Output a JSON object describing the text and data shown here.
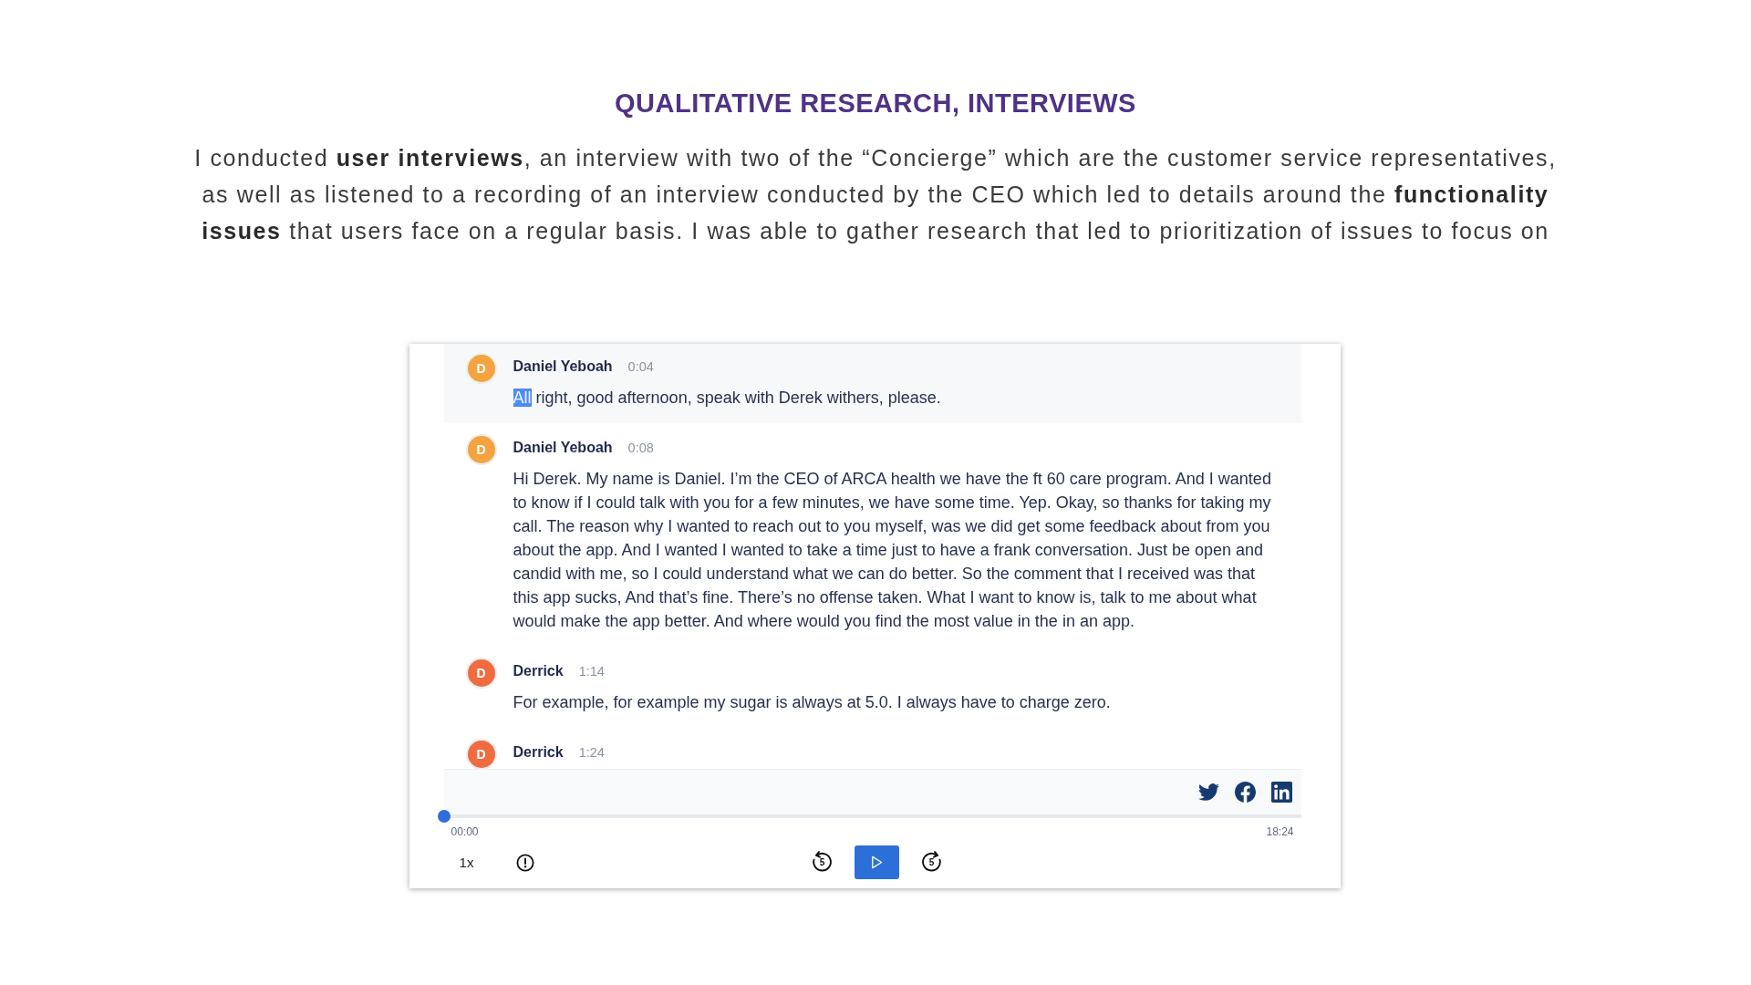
{
  "heading": "QUALITATIVE RESEARCH, INTERVIEWS",
  "intro": "I conducted **user interviews**, an interview with two of the “Concierge” which are the customer service representatives, as well as listened to a recording of an interview conducted by the CEO which led to details around the **functionality issues** that users face on a regular basis. I was able to gather research that led to prioritization of issues to focus on",
  "transcript": {
    "messages": [
      {
        "speaker": "Daniel Yeboah",
        "initial": "D",
        "color": "#f5a33e",
        "time": "0:04",
        "segments": [
          {
            "text": "All",
            "highlighted": true
          },
          {
            "text": " right, good afternoon, speak with Derek withers, please.",
            "highlighted": false
          }
        ]
      },
      {
        "speaker": "Daniel Yeboah",
        "initial": "D",
        "color": "#f5a33e",
        "time": "0:08",
        "segments": [
          {
            "text": "Hi Derek. My name is Daniel. I’m the CEO of ARCA health we have the ft 60 care program. And I wanted to know if I could talk with you for a few minutes, we have some time. Yep. Okay, so thanks for taking my call. The reason why I wanted to reach out to you myself, was we did get some feedback about from you about the app. And I wanted I wanted to take a time just to have a frank conversation. Just be open and candid with me, so I could understand what we can do better. So the comment that I received was that this app sucks, And that’s fine. There’s no offense taken. What I want to know is, talk to me about what would make the app better. And where would you find the most value in the in an app.",
            "highlighted": false
          }
        ]
      },
      {
        "speaker": "Derrick",
        "initial": "D",
        "color": "#f06b40",
        "time": "1:14",
        "segments": [
          {
            "text": "For example, for example my sugar is always at 5.0. I always have to charge zero.",
            "highlighted": false
          }
        ]
      },
      {
        "speaker": "Derrick",
        "initial": "D",
        "color": "#f06b40",
        "time": "1:24"
      }
    ]
  },
  "player": {
    "level": 0,
    "elapsed": "00:00",
    "duration": "18:24",
    "speed": "1x",
    "skip_back": "5",
    "skip_forward": "5"
  }
}
